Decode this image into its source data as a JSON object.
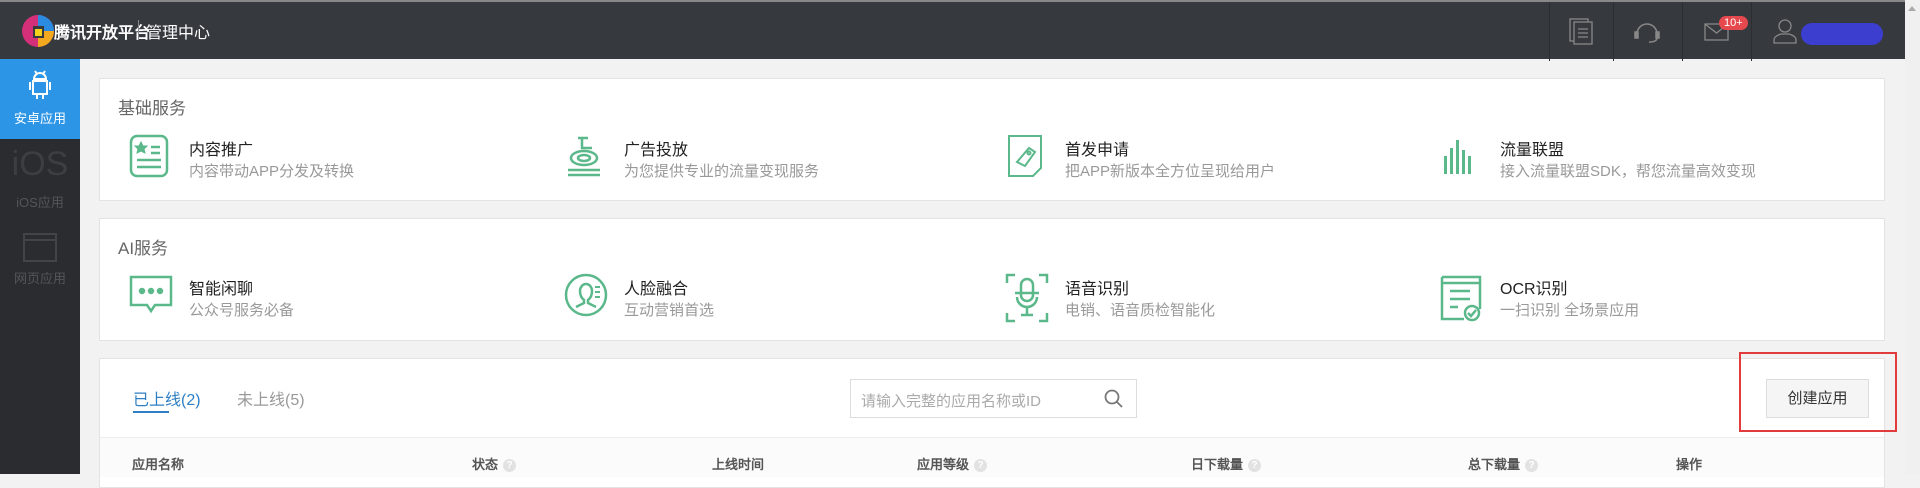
{
  "header": {
    "brand": "腾讯开放平台",
    "section": "管理中心",
    "badge": "10+"
  },
  "sidebar": {
    "items": [
      {
        "label": "安卓应用",
        "icon_text": ""
      },
      {
        "label": "iOS应用",
        "icon_text": "iOS"
      },
      {
        "label": "网页应用",
        "icon_text": ""
      }
    ]
  },
  "basic": {
    "title": "基础服务",
    "items": [
      {
        "title": "内容推广",
        "desc": "内容带动APP分发及转换"
      },
      {
        "title": "广告投放",
        "desc": "为您提供专业的流量变现服务"
      },
      {
        "title": "首发申请",
        "desc": "把APP新版本全方位呈现给用户"
      },
      {
        "title": "流量联盟",
        "desc": "接入流量联盟SDK，帮您流量高效变现"
      }
    ]
  },
  "ai": {
    "title": "AI服务",
    "items": [
      {
        "title": "智能闲聊",
        "desc": "公众号服务必备"
      },
      {
        "title": "人脸融合",
        "desc": "互动营销首选"
      },
      {
        "title": "语音识别",
        "desc": "电销、语音质检智能化"
      },
      {
        "title": "OCR识别",
        "desc": "一扫识别 全场景应用"
      }
    ]
  },
  "apps": {
    "tabs": [
      {
        "label": "已上线(2)"
      },
      {
        "label": "未上线(5)"
      }
    ],
    "search_placeholder": "请输入完整的应用名称或ID",
    "create_label": "创建应用",
    "columns": [
      {
        "label": "应用名称",
        "help": false
      },
      {
        "label": "状态",
        "help": true
      },
      {
        "label": "上线时间",
        "help": false
      },
      {
        "label": "应用等级",
        "help": true
      },
      {
        "label": "日下载量",
        "help": true
      },
      {
        "label": "总下载量",
        "help": true
      },
      {
        "label": "操作",
        "help": false
      }
    ]
  },
  "colors": {
    "accent": "#2d95e6",
    "green": "#5bb88a",
    "header": "#36393e"
  }
}
